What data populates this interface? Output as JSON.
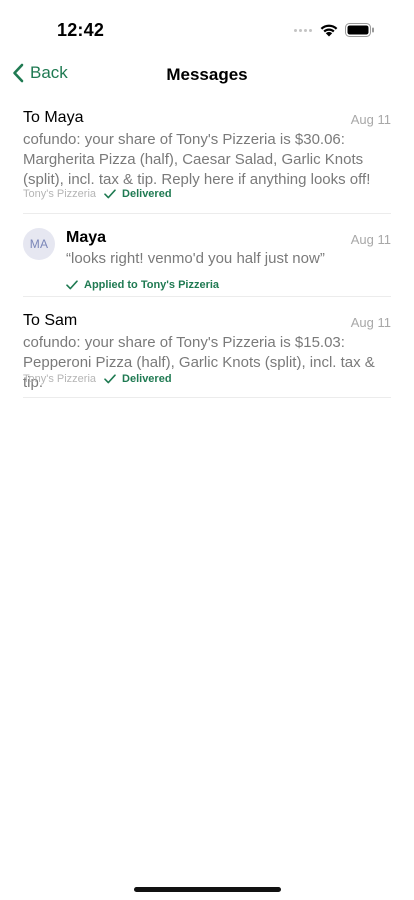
{
  "status_bar": {
    "time": "12:42"
  },
  "nav": {
    "back_label": "Back",
    "title": "Messages"
  },
  "messages": [
    {
      "to": "To Maya",
      "date": "Aug 11",
      "body": "cofundo: your share of Tony's Pizzeria is $30.06: Margherita Pizza (half), Caesar Salad, Garlic Knots (split), incl. tax & tip. Reply here if anything looks off!",
      "source": "Tony's Pizzeria",
      "status": "Delivered"
    },
    {
      "avatar_initials": "MA",
      "sender": "Maya",
      "date": "Aug 11",
      "quote": "“looks right! venmo'd you half just now”",
      "status": "Applied to Tony's Pizzeria"
    },
    {
      "to": "To Sam",
      "date": "Aug 11",
      "body": "cofundo: your share of Tony's Pizzeria is $15.03: Pepperoni Pizza (half), Garlic Knots (split), incl. tax & tip.",
      "source": "Tony's Pizzeria",
      "status": "Delivered"
    }
  ],
  "colors": {
    "accent": "#1f7a52",
    "muted": "#7a7a7a",
    "date": "#a8a8a8"
  },
  "icons": {
    "back": "chevron-left-icon",
    "status": "checkmark-icon"
  }
}
